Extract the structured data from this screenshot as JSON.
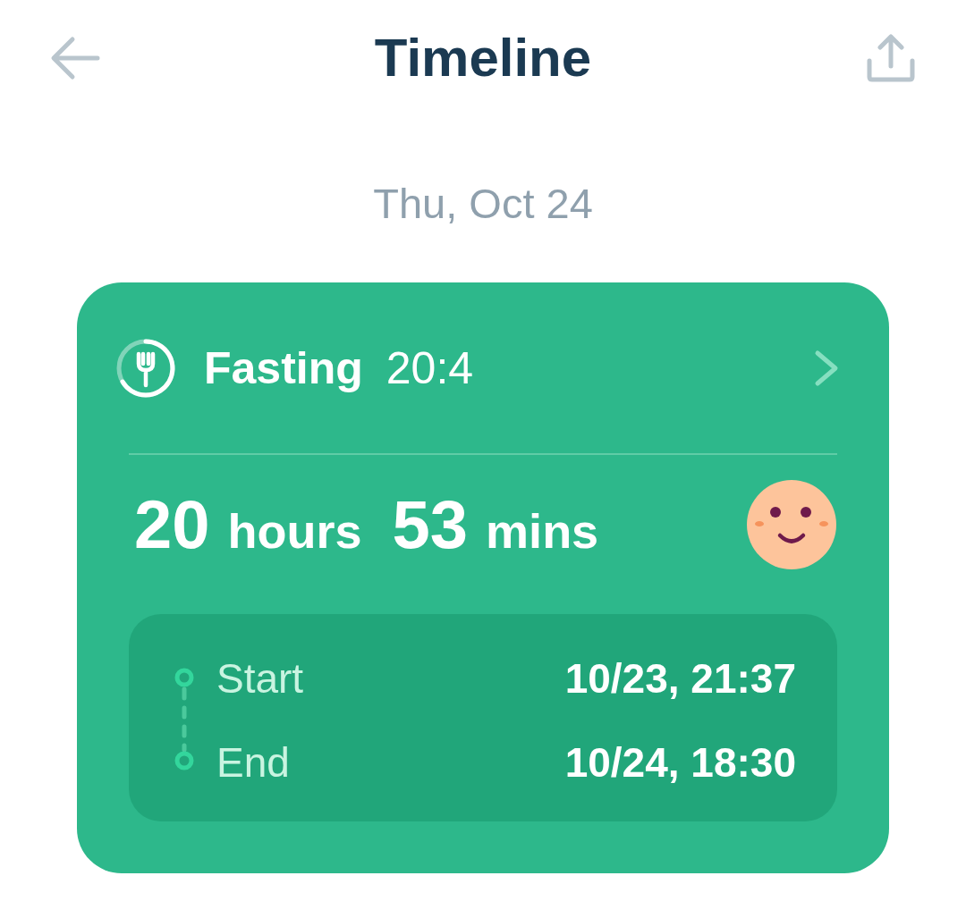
{
  "header": {
    "title": "Timeline"
  },
  "date": "Thu, Oct 24",
  "card": {
    "plan_label": "Fasting",
    "plan_ratio": "20:4",
    "duration": [
      {
        "value": "20",
        "unit": "hours"
      },
      {
        "value": "53",
        "unit": "mins"
      }
    ],
    "times": [
      {
        "label": "Start",
        "value": "10/23, 21:37"
      },
      {
        "label": "End",
        "value": "10/24, 18:30"
      }
    ]
  }
}
